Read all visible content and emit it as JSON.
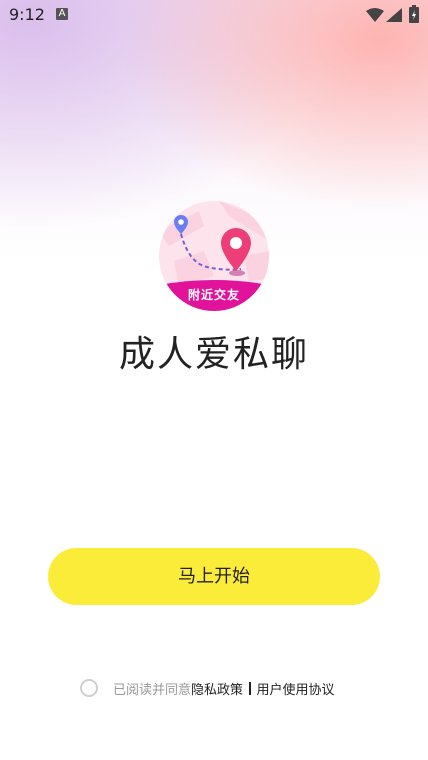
{
  "status_bar": {
    "time": "9:12",
    "notification_icon_letter": "A",
    "icons": [
      "wifi-icon",
      "signal-icon",
      "battery-icon"
    ]
  },
  "logo": {
    "label": "附近交友",
    "icon": "map-route-pin-icon",
    "colors": {
      "pin": "#ee3e78",
      "start_pin": "#6a7ef0",
      "band": "#e0139a",
      "map_bg": "#fce4ee"
    }
  },
  "app_name": "成人爱私聊",
  "start_button": {
    "label": "马上开始",
    "color": "#fcec3a"
  },
  "agreement": {
    "checked": false,
    "prefix": "已阅读并同意",
    "privacy_link": "隐私政策",
    "terms_link": "用户使用协议"
  }
}
